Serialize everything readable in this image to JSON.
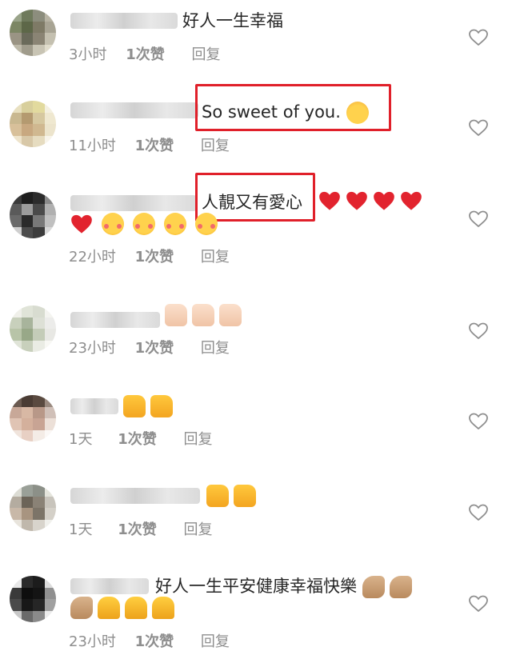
{
  "comments": [
    {
      "text": "好人一生幸福",
      "time": "3小时",
      "likes": "1次赞",
      "reply": "回复"
    },
    {
      "text": "So sweet of you.",
      "emoji": "woman-emoji",
      "time": "11小时",
      "likes": "1次赞",
      "reply": "回复"
    },
    {
      "text": "人靚又有愛心",
      "time": "22小时",
      "likes": "1次赞",
      "reply": "回复"
    },
    {
      "text": "",
      "time": "23小时",
      "likes": "1次赞",
      "reply": "回复"
    },
    {
      "text": "",
      "time": "1天",
      "likes": "1次赞",
      "reply": "回复"
    },
    {
      "text": "",
      "time": "1天",
      "likes": "1次赞",
      "reply": "回复"
    },
    {
      "text": "好人一生平安健康幸福快樂",
      "time": "23小时",
      "likes": "1次赞",
      "reply": "回复"
    }
  ],
  "colors": {
    "highlight": "#e0202a",
    "meta": "#8e8e8e",
    "text": "#262626"
  }
}
